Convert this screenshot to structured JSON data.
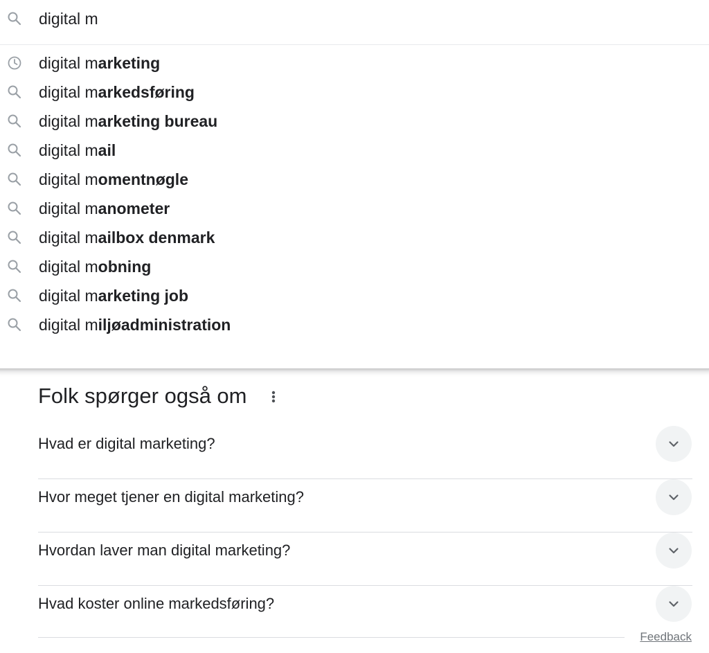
{
  "search": {
    "query": "digital m",
    "icon": "search-icon"
  },
  "suggestions": [
    {
      "prefix": "digital m",
      "completion": "arketing",
      "icon": "history-icon"
    },
    {
      "prefix": "digital m",
      "completion": "arkedsføring",
      "icon": "search-icon"
    },
    {
      "prefix": "digital m",
      "completion": "arketing bureau",
      "icon": "search-icon"
    },
    {
      "prefix": "digital m",
      "completion": "ail",
      "icon": "search-icon"
    },
    {
      "prefix": "digital m",
      "completion": "omentnøgle",
      "icon": "search-icon"
    },
    {
      "prefix": "digital m",
      "completion": "anometer",
      "icon": "search-icon"
    },
    {
      "prefix": "digital m",
      "completion": "ailbox denmark",
      "icon": "search-icon"
    },
    {
      "prefix": "digital m",
      "completion": "obning",
      "icon": "search-icon"
    },
    {
      "prefix": "digital m",
      "completion": "arketing job",
      "icon": "search-icon"
    },
    {
      "prefix": "digital m",
      "completion": "iljøadministration",
      "icon": "search-icon"
    }
  ],
  "people_also_ask": {
    "title": "Folk spørger også om",
    "more_icon": "more-vert-icon",
    "questions": [
      {
        "label": "Hvad er digital marketing?"
      },
      {
        "label": "Hvor meget tjener en digital marketing?"
      },
      {
        "label": "Hvordan laver man digital marketing?"
      },
      {
        "label": "Hvad koster online markedsføring?"
      }
    ],
    "feedback_label": "Feedback"
  },
  "colors": {
    "text": "#202124",
    "icon": "#9aa0a6",
    "divider": "#dadce0",
    "chip_bg": "#f1f3f4",
    "muted": "#70757a"
  }
}
